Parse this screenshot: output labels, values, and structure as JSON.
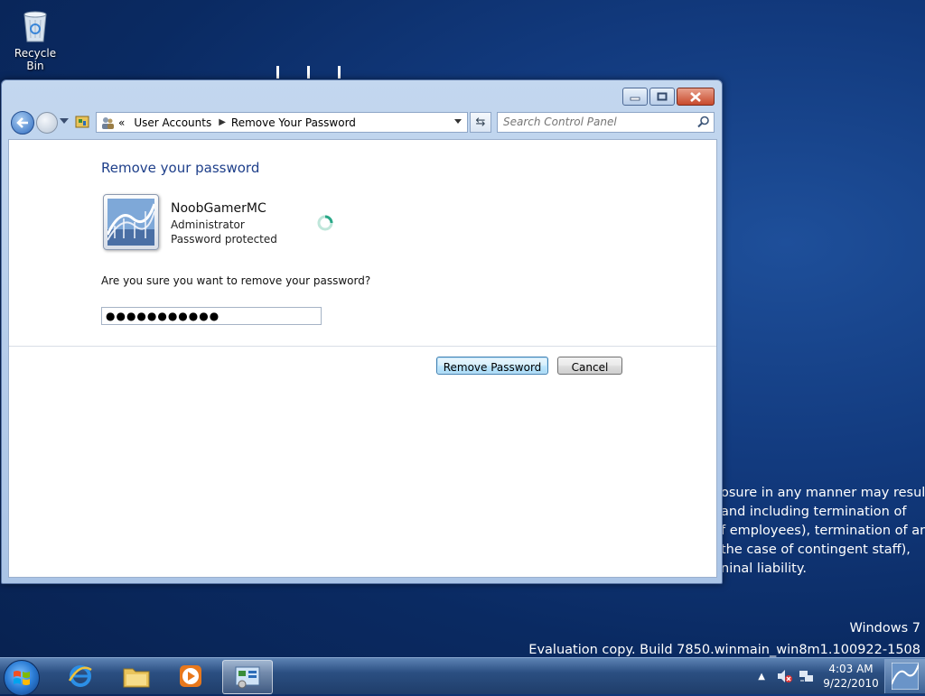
{
  "desktop": {
    "recycle_bin_label": "Recycle Bin",
    "confidential_lines": [
      "osure in any manner may result",
      "and including termination of",
      "f employees), termination of an",
      "the case of contingent staff),",
      "ninal liability."
    ],
    "watermark": {
      "line1": "Windows 7",
      "line2": "Evaluation copy. Build 7850.winmain_win8m1.100922-1508"
    }
  },
  "window": {
    "address": {
      "overflow": "«",
      "crumbs": [
        "User Accounts",
        "Remove Your Password"
      ]
    },
    "search": {
      "placeholder": "Search Control Panel"
    },
    "content": {
      "heading": "Remove your password",
      "user": {
        "name": "NoobGamerMC",
        "role": "Administrator",
        "status": "Password protected"
      },
      "question": "Are you sure you want to remove your password?",
      "password_value": "●●●●●●●●●●●",
      "buttons": {
        "primary": "Remove Password",
        "cancel": "Cancel"
      }
    }
  },
  "taskbar": {
    "pinned": [
      "start-orb",
      "internet-explorer-icon",
      "windows-explorer-icon",
      "media-player-icon",
      "control-panel-icon"
    ],
    "clock": {
      "time": "4:03 AM",
      "date": "9/22/2010"
    }
  },
  "colors": {
    "heading": "#1e3f8a",
    "desktop_bg": "#0a2a62",
    "primary_button_border": "#3c7fb1"
  }
}
